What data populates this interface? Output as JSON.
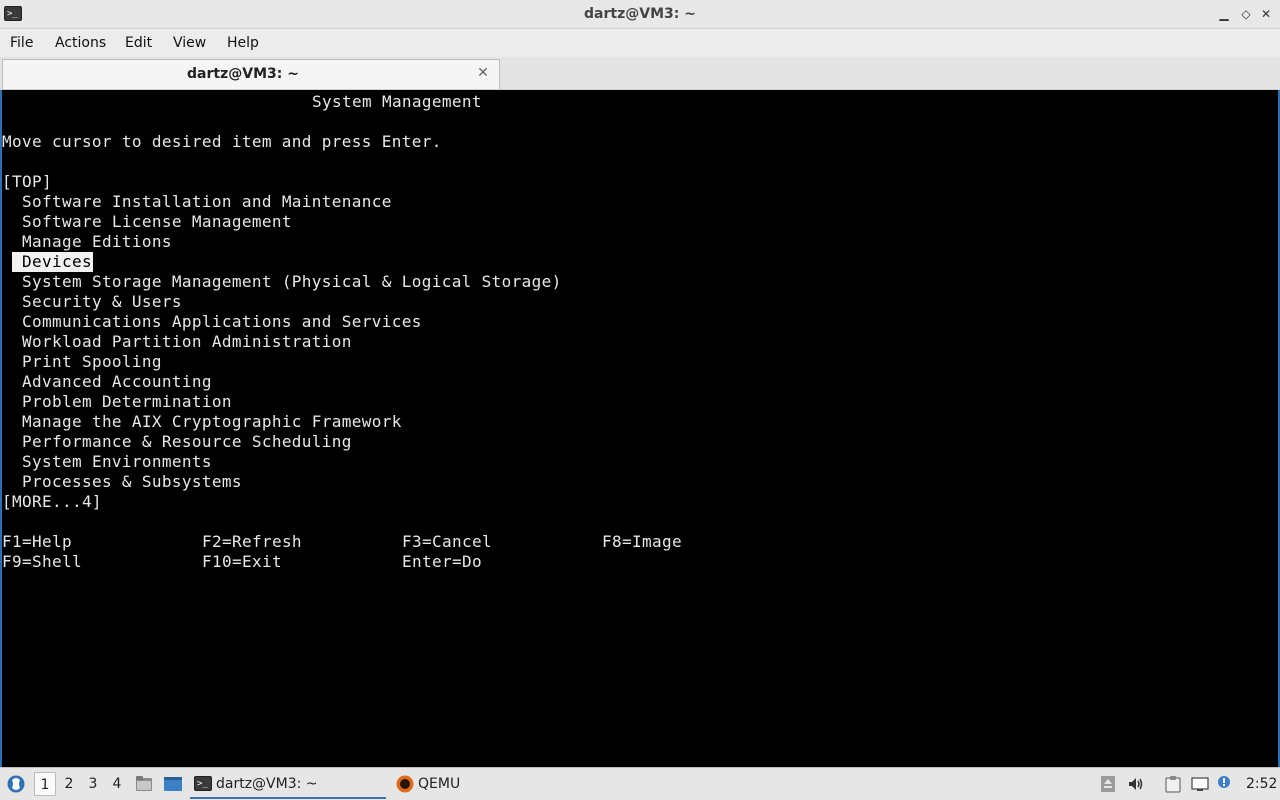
{
  "window": {
    "title": "dartz@VM3: ~",
    "controls": {
      "minimize": "▁",
      "maximize": "◇",
      "close": "✕"
    }
  },
  "menubar": {
    "items": [
      "File",
      "Actions",
      "Edit",
      "View",
      "Help"
    ]
  },
  "tabs": [
    {
      "label": "dartz@VM3: ~",
      "close": "✕"
    }
  ],
  "terminal": {
    "heading": "System Management",
    "instruction": "Move cursor to desired item and press Enter.",
    "top_marker": "[TOP]",
    "menu_items": [
      "Software Installation and Maintenance",
      "Software License Management",
      "Manage Editions",
      "Devices",
      "System Storage Management (Physical & Logical Storage)",
      "Security & Users",
      "Communications Applications and Services",
      "Workload Partition Administration",
      "Print Spooling",
      "Advanced Accounting",
      "Problem Determination",
      "Manage the AIX Cryptographic Framework",
      "Performance & Resource Scheduling",
      "System Environments",
      "Processes & Subsystems"
    ],
    "selected_item": "Devices",
    "more_marker": "[MORE...4]",
    "function_keys": {
      "row1": [
        "F1=Help",
        "F2=Refresh",
        "F3=Cancel",
        "F8=Image"
      ],
      "row2": [
        "F9=Shell",
        "F10=Exit",
        "Enter=Do"
      ]
    },
    "colors": {
      "background": "#000000",
      "foreground": "#e8e8e8",
      "selection_bg": "#f2f2f2",
      "selection_fg": "#000000"
    }
  },
  "taskbar": {
    "desktops": [
      "1",
      "2",
      "3",
      "4"
    ],
    "active_desktop": "1",
    "launchers": [
      "menu-icon",
      "file-manager-icon",
      "show-desktop-icon"
    ],
    "tasks": [
      {
        "label": "dartz@VM3: ~",
        "icon": "terminal-icon",
        "active": true
      },
      {
        "label": "QEMU",
        "icon": "qemu-icon",
        "active": false
      }
    ],
    "tray_icons": [
      "removable-drive-icon",
      "volume-icon",
      "clipboard-icon",
      "network-icon",
      "notification-icon"
    ],
    "clock": "2:52",
    "accent": "#3b73b9"
  }
}
